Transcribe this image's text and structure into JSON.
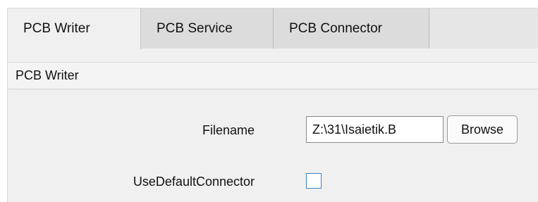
{
  "tabs": [
    {
      "label": "PCB Writer",
      "active": true
    },
    {
      "label": "PCB Service",
      "active": false
    },
    {
      "label": "PCB Connector",
      "active": false
    }
  ],
  "section": {
    "title": "PCB Writer"
  },
  "form": {
    "filename": {
      "label": "Filename",
      "value": "Z:\\31\\Isaietik.B"
    },
    "browse_label": "Browse",
    "use_default_connector": {
      "label": "UseDefaultConnector",
      "checked": false
    }
  },
  "colors": {
    "panel_bg": "#f0f0f0",
    "inactive_tab_bg": "#dcdcdc",
    "checkbox_border": "#3b82c4"
  }
}
